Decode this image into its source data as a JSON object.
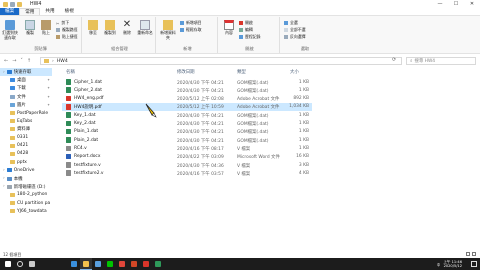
{
  "window": {
    "title": "HW4",
    "controls": [
      "—",
      "☐",
      "✕"
    ]
  },
  "ribbon_tabs": [
    "檔案",
    "常用",
    "共用",
    "檢視"
  ],
  "ribbon": {
    "clipboard": {
      "label": "剪貼簿",
      "pin": "釘選到快速存取",
      "copy": "複製",
      "paste": "貼上",
      "cut": "剪下",
      "copy_path": "複製路徑",
      "paste_shortcut": "貼上捷徑"
    },
    "organize": {
      "label": "組合管理",
      "move_to": "移至",
      "copy_to": "複製到",
      "delete": "刪除",
      "rename": "重新命名"
    },
    "new": {
      "label": "新增",
      "new_folder": "新增資料夾",
      "new_item": "新增項目",
      "easy_access": "輕鬆存取"
    },
    "open": {
      "label": "開啟",
      "properties": "內容",
      "open_btn": "開啟",
      "edit": "編輯",
      "history": "歷程記錄"
    },
    "select": {
      "label": "選取",
      "select_all": "全選",
      "select_none": "全部不選",
      "invert": "反向選擇"
    }
  },
  "address": {
    "path": "HW4",
    "search_placeholder": "搜尋 HW4"
  },
  "nav_pane": [
    {
      "label": "快速存取",
      "color": "#2b7cd3",
      "selected": true,
      "sub": false,
      "pinned": false
    },
    {
      "label": "桌面",
      "color": "#3c8be0",
      "selected": false,
      "sub": true,
      "pinned": true
    },
    {
      "label": "下載",
      "color": "#3c8be0",
      "selected": false,
      "sub": true,
      "pinned": true
    },
    {
      "label": "文件",
      "color": "#8aa8c8",
      "selected": false,
      "sub": true,
      "pinned": true
    },
    {
      "label": "圖片",
      "color": "#6aa4d8",
      "selected": false,
      "sub": true,
      "pinned": true
    },
    {
      "label": "PostPaperRole",
      "color": "#e8c15a",
      "selected": false,
      "sub": true,
      "pinned": false
    },
    {
      "label": "EqTabs",
      "color": "#e8c15a",
      "selected": false,
      "sub": true,
      "pinned": false
    },
    {
      "label": "資料庫",
      "color": "#e8c15a",
      "selected": false,
      "sub": true,
      "pinned": false
    },
    {
      "label": "0331",
      "color": "#e8c15a",
      "selected": false,
      "sub": true,
      "pinned": false
    },
    {
      "label": "0421",
      "color": "#e8c15a",
      "selected": false,
      "sub": true,
      "pinned": false
    },
    {
      "label": "0428",
      "color": "#e8c15a",
      "selected": false,
      "sub": true,
      "pinned": false
    },
    {
      "label": "pptx",
      "color": "#e8c15a",
      "selected": false,
      "sub": true,
      "pinned": false
    },
    {
      "label": "OneDrive",
      "color": "#2b7cd3",
      "selected": false,
      "sub": false,
      "pinned": false
    },
    {
      "label": "本機",
      "color": "#5a8fc8",
      "selected": false,
      "sub": false,
      "pinned": false
    },
    {
      "label": "新增磁碟區 (D:)",
      "color": "#9aa5b0",
      "selected": false,
      "sub": false,
      "pinned": false
    },
    {
      "label": "180-2_python",
      "color": "#e8c15a",
      "selected": false,
      "sub": true,
      "pinned": false
    },
    {
      "label": "CU partition pa",
      "color": "#e8c15a",
      "selected": false,
      "sub": true,
      "pinned": false
    },
    {
      "label": "YJ66_towdata",
      "color": "#e8c15a",
      "selected": false,
      "sub": true,
      "pinned": false
    }
  ],
  "columns": {
    "name": "名稱",
    "date": "修改日期",
    "type": "類型",
    "size": "大小"
  },
  "files": [
    {
      "name": "Cipher_1.dat",
      "date": "2020/4/30 下午 04:21",
      "type": "GOM檔案(.dat)",
      "size": "1 KB",
      "color": "#2e8b57",
      "selected": false
    },
    {
      "name": "Cipher_2.dat",
      "date": "2020/4/30 下午 04:21",
      "type": "GOM檔案(.dat)",
      "size": "1 KB",
      "color": "#2e8b57",
      "selected": false
    },
    {
      "name": "HW4_eng.pdf",
      "date": "2020/5/12 上午 02:08",
      "type": "Adobe Acrobat 文件",
      "size": "892 KB",
      "color": "#d9352a",
      "selected": false
    },
    {
      "name": "HW4說明.pdf",
      "date": "2020/5/12 上午 10:59",
      "type": "Adobe Acrobat 文件",
      "size": "1,034 KB",
      "color": "#d9352a",
      "selected": true
    },
    {
      "name": "Key_1.dat",
      "date": "2020/4/30 下午 04:21",
      "type": "GOM檔案(.dat)",
      "size": "1 KB",
      "color": "#2e8b57",
      "selected": false
    },
    {
      "name": "Key_2.dat",
      "date": "2020/4/30 下午 04:21",
      "type": "GOM檔案(.dat)",
      "size": "1 KB",
      "color": "#2e8b57",
      "selected": false
    },
    {
      "name": "Plain_1.dat",
      "date": "2020/4/30 下午 04:21",
      "type": "GOM檔案(.dat)",
      "size": "1 KB",
      "color": "#2e8b57",
      "selected": false
    },
    {
      "name": "Plain_2.dat",
      "date": "2020/4/30 下午 04:21",
      "type": "GOM檔案(.dat)",
      "size": "1 KB",
      "color": "#2e8b57",
      "selected": false
    },
    {
      "name": "RC4.v",
      "date": "2020/4/16 下午 08:17",
      "type": "V 檔案",
      "size": "1 KB",
      "color": "#8a8a8a",
      "selected": false
    },
    {
      "name": "Report.docx",
      "date": "2020/4/22 下午 03:09",
      "type": "Microsoft Word 文件",
      "size": "16 KB",
      "color": "#2b5fb8",
      "selected": false
    },
    {
      "name": "testfixture.v",
      "date": "2020/4/30 下午 04:36",
      "type": "V 檔案",
      "size": "3 KB",
      "color": "#8a8a8a",
      "selected": false
    },
    {
      "name": "testfixture2.v",
      "date": "2020/4/16 下午 03:57",
      "type": "V 檔案",
      "size": "4 KB",
      "color": "#8a8a8a",
      "selected": false
    }
  ],
  "status": {
    "text": "12 個項目"
  },
  "taskbar": {
    "apps": [
      {
        "name": "windows-start",
        "color": "#ffffff"
      },
      {
        "name": "search",
        "color": "#dddddd"
      },
      {
        "name": "task-view",
        "color": "#cccccc"
      },
      {
        "name": "edge",
        "color": "#3a8fdc"
      },
      {
        "name": "file-explorer",
        "color": "#f2c14e"
      },
      {
        "name": "store",
        "color": "#5aa0e0"
      },
      {
        "name": "line",
        "color": "#00c300"
      },
      {
        "name": "chrome",
        "color": "#e0463a"
      },
      {
        "name": "powerpoint",
        "color": "#d24726"
      },
      {
        "name": "acrobat",
        "color": "#d9352a"
      },
      {
        "name": "app-green",
        "color": "#2e9a5a"
      }
    ],
    "tray": {
      "lang": "中",
      "time": "上午 11:46",
      "date": "2020/5/12"
    }
  }
}
